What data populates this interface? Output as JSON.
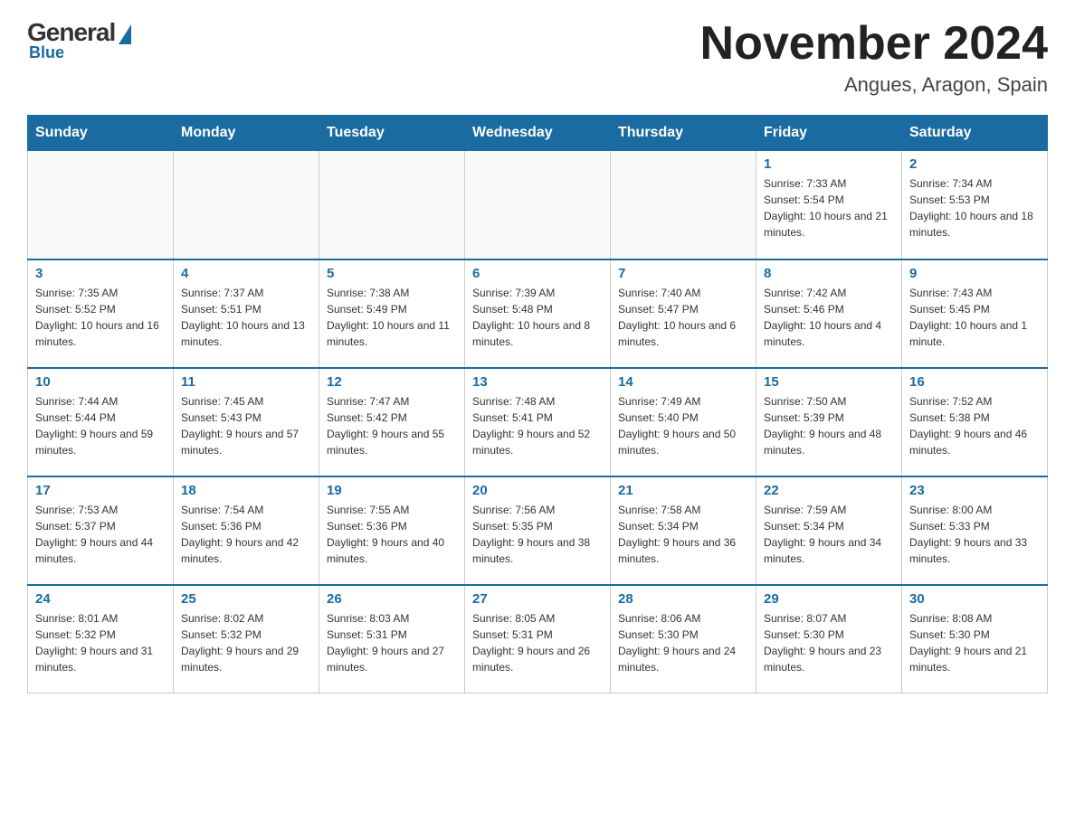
{
  "header": {
    "logo": {
      "general_text": "General",
      "blue_text": "Blue"
    },
    "month_year": "November 2024",
    "location": "Angues, Aragon, Spain"
  },
  "days_of_week": [
    "Sunday",
    "Monday",
    "Tuesday",
    "Wednesday",
    "Thursday",
    "Friday",
    "Saturday"
  ],
  "weeks": [
    {
      "days": [
        {
          "number": "",
          "sunrise": "",
          "sunset": "",
          "daylight": ""
        },
        {
          "number": "",
          "sunrise": "",
          "sunset": "",
          "daylight": ""
        },
        {
          "number": "",
          "sunrise": "",
          "sunset": "",
          "daylight": ""
        },
        {
          "number": "",
          "sunrise": "",
          "sunset": "",
          "daylight": ""
        },
        {
          "number": "",
          "sunrise": "",
          "sunset": "",
          "daylight": ""
        },
        {
          "number": "1",
          "sunrise": "Sunrise: 7:33 AM",
          "sunset": "Sunset: 5:54 PM",
          "daylight": "Daylight: 10 hours and 21 minutes."
        },
        {
          "number": "2",
          "sunrise": "Sunrise: 7:34 AM",
          "sunset": "Sunset: 5:53 PM",
          "daylight": "Daylight: 10 hours and 18 minutes."
        }
      ]
    },
    {
      "days": [
        {
          "number": "3",
          "sunrise": "Sunrise: 7:35 AM",
          "sunset": "Sunset: 5:52 PM",
          "daylight": "Daylight: 10 hours and 16 minutes."
        },
        {
          "number": "4",
          "sunrise": "Sunrise: 7:37 AM",
          "sunset": "Sunset: 5:51 PM",
          "daylight": "Daylight: 10 hours and 13 minutes."
        },
        {
          "number": "5",
          "sunrise": "Sunrise: 7:38 AM",
          "sunset": "Sunset: 5:49 PM",
          "daylight": "Daylight: 10 hours and 11 minutes."
        },
        {
          "number": "6",
          "sunrise": "Sunrise: 7:39 AM",
          "sunset": "Sunset: 5:48 PM",
          "daylight": "Daylight: 10 hours and 8 minutes."
        },
        {
          "number": "7",
          "sunrise": "Sunrise: 7:40 AM",
          "sunset": "Sunset: 5:47 PM",
          "daylight": "Daylight: 10 hours and 6 minutes."
        },
        {
          "number": "8",
          "sunrise": "Sunrise: 7:42 AM",
          "sunset": "Sunset: 5:46 PM",
          "daylight": "Daylight: 10 hours and 4 minutes."
        },
        {
          "number": "9",
          "sunrise": "Sunrise: 7:43 AM",
          "sunset": "Sunset: 5:45 PM",
          "daylight": "Daylight: 10 hours and 1 minute."
        }
      ]
    },
    {
      "days": [
        {
          "number": "10",
          "sunrise": "Sunrise: 7:44 AM",
          "sunset": "Sunset: 5:44 PM",
          "daylight": "Daylight: 9 hours and 59 minutes."
        },
        {
          "number": "11",
          "sunrise": "Sunrise: 7:45 AM",
          "sunset": "Sunset: 5:43 PM",
          "daylight": "Daylight: 9 hours and 57 minutes."
        },
        {
          "number": "12",
          "sunrise": "Sunrise: 7:47 AM",
          "sunset": "Sunset: 5:42 PM",
          "daylight": "Daylight: 9 hours and 55 minutes."
        },
        {
          "number": "13",
          "sunrise": "Sunrise: 7:48 AM",
          "sunset": "Sunset: 5:41 PM",
          "daylight": "Daylight: 9 hours and 52 minutes."
        },
        {
          "number": "14",
          "sunrise": "Sunrise: 7:49 AM",
          "sunset": "Sunset: 5:40 PM",
          "daylight": "Daylight: 9 hours and 50 minutes."
        },
        {
          "number": "15",
          "sunrise": "Sunrise: 7:50 AM",
          "sunset": "Sunset: 5:39 PM",
          "daylight": "Daylight: 9 hours and 48 minutes."
        },
        {
          "number": "16",
          "sunrise": "Sunrise: 7:52 AM",
          "sunset": "Sunset: 5:38 PM",
          "daylight": "Daylight: 9 hours and 46 minutes."
        }
      ]
    },
    {
      "days": [
        {
          "number": "17",
          "sunrise": "Sunrise: 7:53 AM",
          "sunset": "Sunset: 5:37 PM",
          "daylight": "Daylight: 9 hours and 44 minutes."
        },
        {
          "number": "18",
          "sunrise": "Sunrise: 7:54 AM",
          "sunset": "Sunset: 5:36 PM",
          "daylight": "Daylight: 9 hours and 42 minutes."
        },
        {
          "number": "19",
          "sunrise": "Sunrise: 7:55 AM",
          "sunset": "Sunset: 5:36 PM",
          "daylight": "Daylight: 9 hours and 40 minutes."
        },
        {
          "number": "20",
          "sunrise": "Sunrise: 7:56 AM",
          "sunset": "Sunset: 5:35 PM",
          "daylight": "Daylight: 9 hours and 38 minutes."
        },
        {
          "number": "21",
          "sunrise": "Sunrise: 7:58 AM",
          "sunset": "Sunset: 5:34 PM",
          "daylight": "Daylight: 9 hours and 36 minutes."
        },
        {
          "number": "22",
          "sunrise": "Sunrise: 7:59 AM",
          "sunset": "Sunset: 5:34 PM",
          "daylight": "Daylight: 9 hours and 34 minutes."
        },
        {
          "number": "23",
          "sunrise": "Sunrise: 8:00 AM",
          "sunset": "Sunset: 5:33 PM",
          "daylight": "Daylight: 9 hours and 33 minutes."
        }
      ]
    },
    {
      "days": [
        {
          "number": "24",
          "sunrise": "Sunrise: 8:01 AM",
          "sunset": "Sunset: 5:32 PM",
          "daylight": "Daylight: 9 hours and 31 minutes."
        },
        {
          "number": "25",
          "sunrise": "Sunrise: 8:02 AM",
          "sunset": "Sunset: 5:32 PM",
          "daylight": "Daylight: 9 hours and 29 minutes."
        },
        {
          "number": "26",
          "sunrise": "Sunrise: 8:03 AM",
          "sunset": "Sunset: 5:31 PM",
          "daylight": "Daylight: 9 hours and 27 minutes."
        },
        {
          "number": "27",
          "sunrise": "Sunrise: 8:05 AM",
          "sunset": "Sunset: 5:31 PM",
          "daylight": "Daylight: 9 hours and 26 minutes."
        },
        {
          "number": "28",
          "sunrise": "Sunrise: 8:06 AM",
          "sunset": "Sunset: 5:30 PM",
          "daylight": "Daylight: 9 hours and 24 minutes."
        },
        {
          "number": "29",
          "sunrise": "Sunrise: 8:07 AM",
          "sunset": "Sunset: 5:30 PM",
          "daylight": "Daylight: 9 hours and 23 minutes."
        },
        {
          "number": "30",
          "sunrise": "Sunrise: 8:08 AM",
          "sunset": "Sunset: 5:30 PM",
          "daylight": "Daylight: 9 hours and 21 minutes."
        }
      ]
    }
  ]
}
